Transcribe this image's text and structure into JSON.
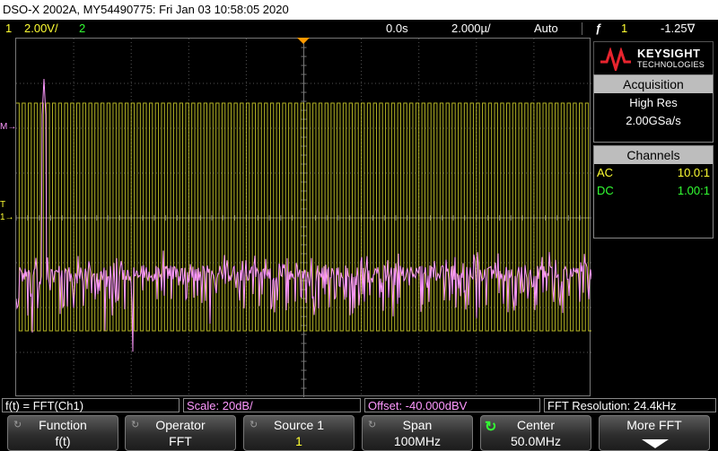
{
  "title": "DSO-X 2002A, MY54490775: Fri Jan 03 10:58:05 2020",
  "status": {
    "ch1_num": "1",
    "ch1_scale": "2.00V/",
    "ch2_num": "2",
    "time_delay": "0.0s",
    "time_scale": "2.000µ/",
    "trigger_mode": "Auto",
    "trigger_icon": "ƒ",
    "trigger_source": "1",
    "trigger_level": "-1.25∇"
  },
  "markers": {
    "math": "M→",
    "trigger": "T",
    "ch1": "1→"
  },
  "logo": {
    "brand": "KEYSIGHT",
    "sub": "TECHNOLOGIES"
  },
  "acquisition": {
    "header": "Acquisition",
    "mode": "High Res",
    "rate": "2.00GSa/s"
  },
  "channels": {
    "header": "Channels",
    "rows": [
      {
        "coupling": "AC",
        "probe": "10.0:1",
        "color": "#ffff33"
      },
      {
        "coupling": "DC",
        "probe": "1.00:1",
        "color": "#33ff33"
      }
    ]
  },
  "info": {
    "function": "f(t) = FFT(Ch1)",
    "scale": "Scale: 20dB/",
    "offset": "Offset: -40.000dBV",
    "resolution": "FFT Resolution: 24.4kHz"
  },
  "softkeys": [
    {
      "top": "Function",
      "bottom": "f(t)",
      "icon": "rotate-icon"
    },
    {
      "top": "Operator",
      "bottom": "FFT",
      "icon": "rotate-icon"
    },
    {
      "top": "Source 1",
      "bottom": "1",
      "icon": "rotate-icon"
    },
    {
      "top": "Span",
      "bottom": "100MHz",
      "icon": "rotate-icon"
    },
    {
      "top": "Center",
      "bottom": "50.0MHz",
      "icon": "knob-icon"
    },
    {
      "top": "More FFT",
      "bottom": "",
      "icon": "down-arrow-icon"
    }
  ],
  "colors": {
    "ch1": "#ffff33",
    "ch2": "#33ff33",
    "math": "#ff99ff",
    "grid": "#555555"
  }
}
